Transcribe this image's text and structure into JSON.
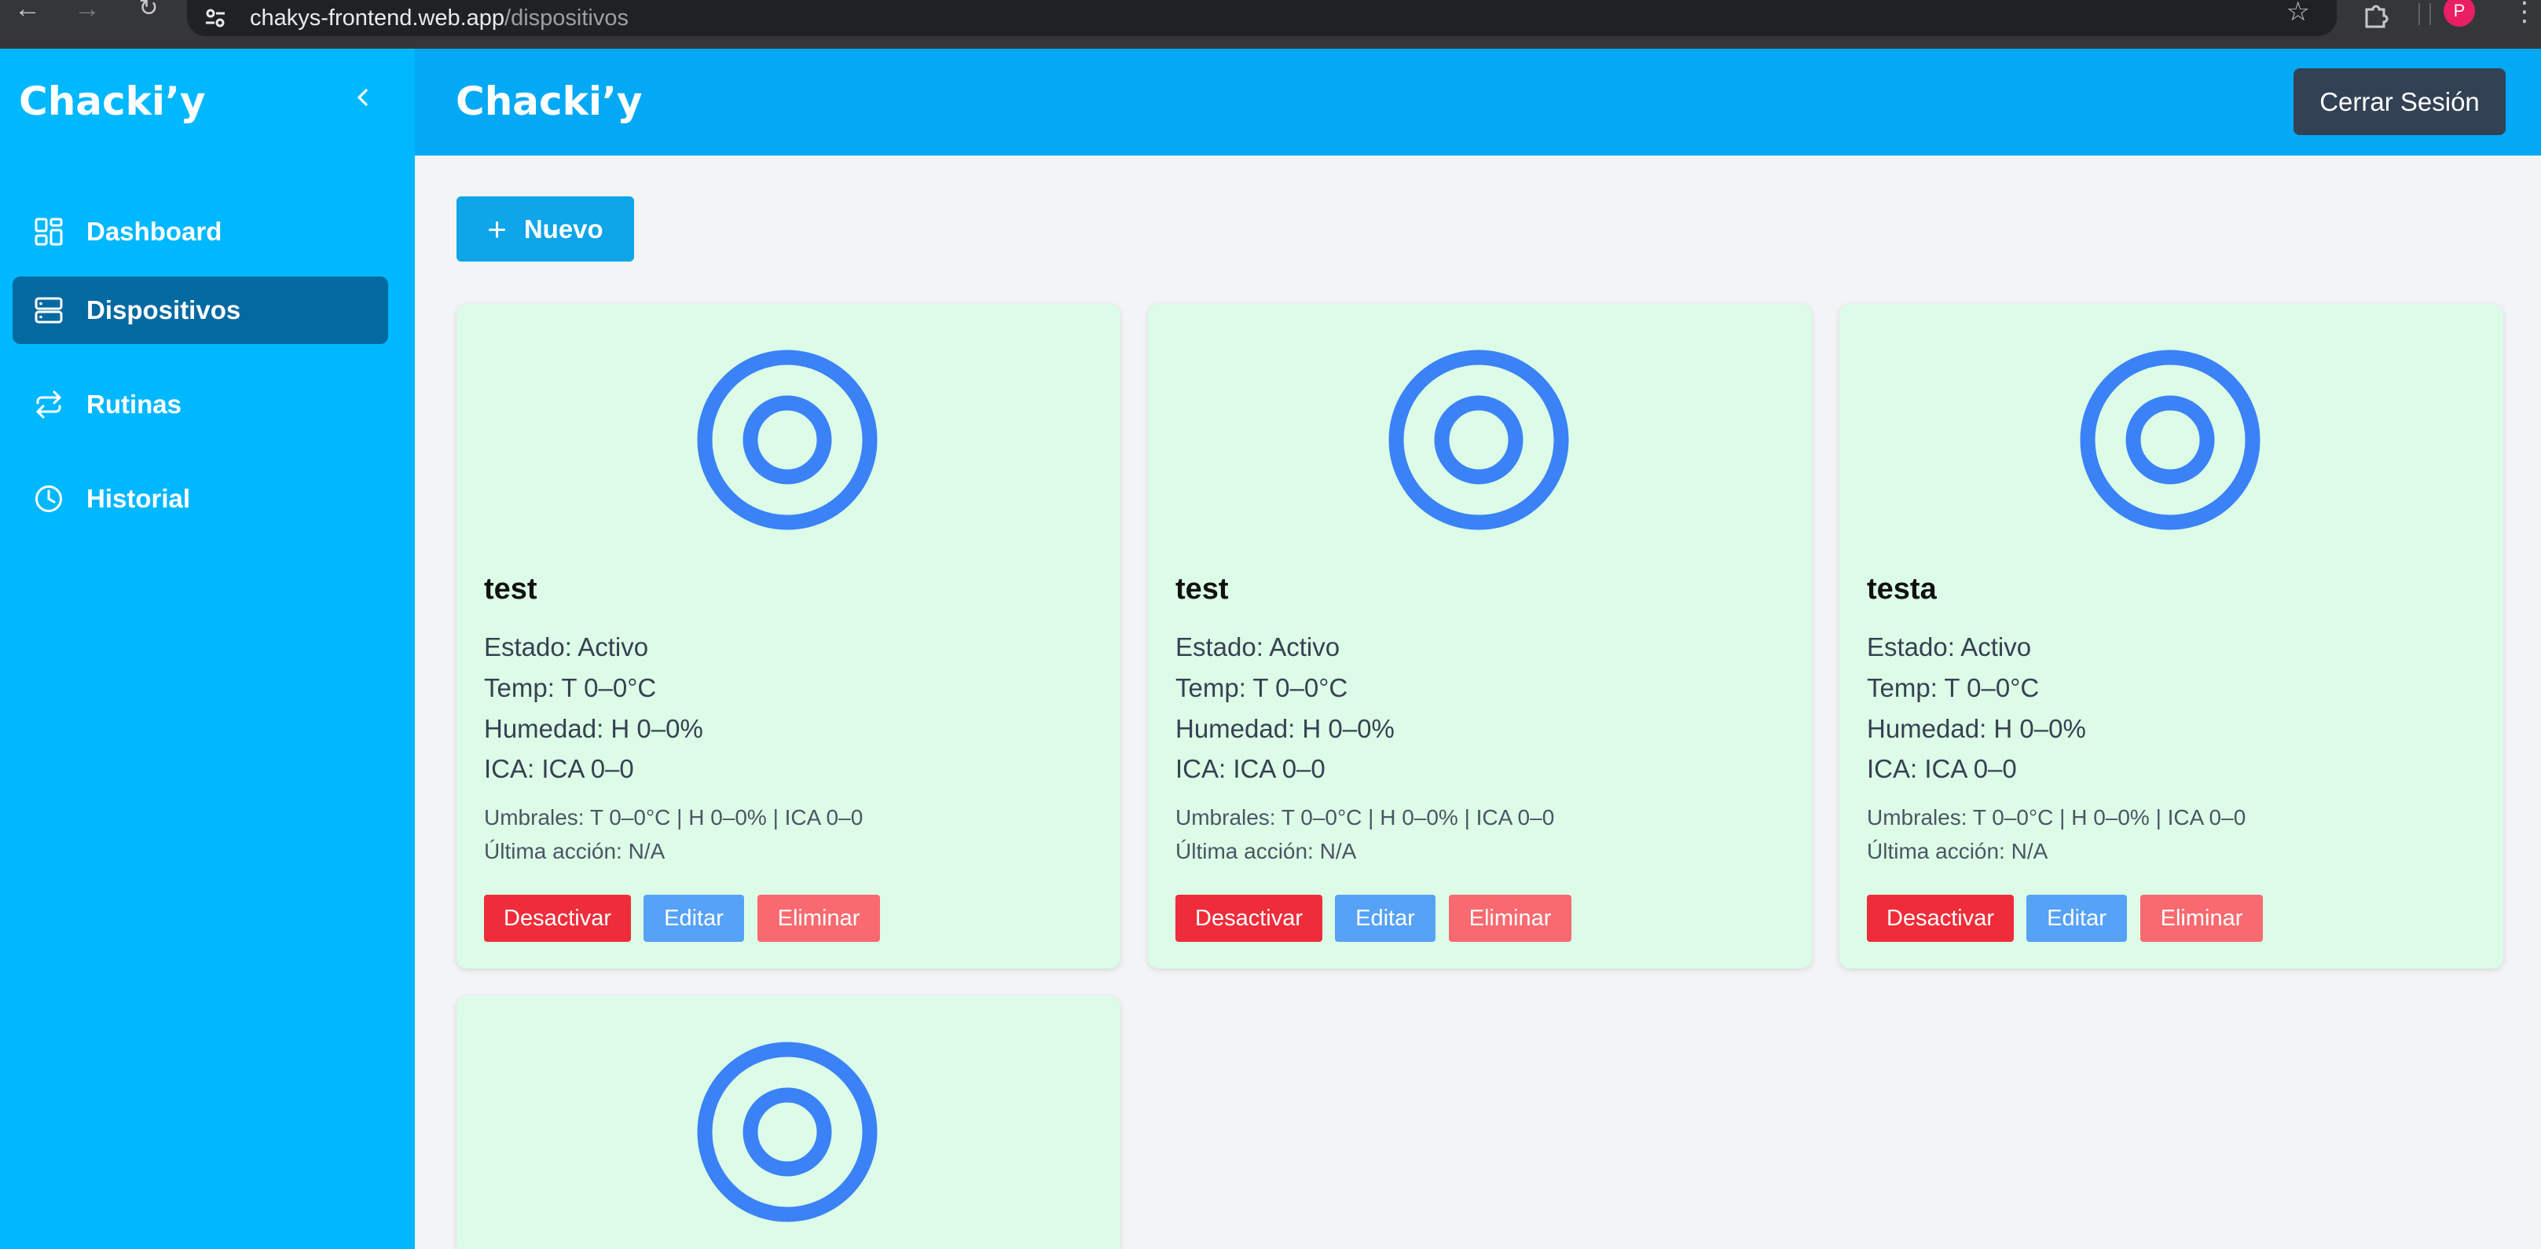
{
  "browser": {
    "url_host": "chakys-frontend.web.app",
    "url_path": "/dispositivos",
    "profile_initial": "P"
  },
  "sidebar": {
    "brand": "Chacki’y",
    "items": [
      {
        "label": "Dashboard",
        "icon": "dashboard-icon"
      },
      {
        "label": "Dispositivos",
        "icon": "server-icon",
        "active": true
      },
      {
        "label": "Rutinas",
        "icon": "repeat-icon"
      },
      {
        "label": "Historial",
        "icon": "clock-icon"
      }
    ]
  },
  "header": {
    "title": "Chacki’y",
    "logout_label": "Cerrar Sesión"
  },
  "main": {
    "new_label": "Nuevo",
    "cards": [
      {
        "name": "test",
        "estado": "Estado: Activo",
        "temp": "Temp: T 0–0°C",
        "humedad": "Humedad: H 0–0%",
        "ica": "ICA: ICA 0–0",
        "umbrales": "Umbrales: T 0–0°C | H 0–0% | ICA 0–0",
        "ultima_accion": "Última acción: N/A",
        "btn_deactivate": "Desactivar",
        "btn_edit": "Editar",
        "btn_delete": "Eliminar"
      },
      {
        "name": "test",
        "estado": "Estado: Activo",
        "temp": "Temp: T 0–0°C",
        "humedad": "Humedad: H 0–0%",
        "ica": "ICA: ICA 0–0",
        "umbrales": "Umbrales: T 0–0°C | H 0–0% | ICA 0–0",
        "ultima_accion": "Última acción: N/A",
        "btn_deactivate": "Desactivar",
        "btn_edit": "Editar",
        "btn_delete": "Eliminar"
      },
      {
        "name": "testa",
        "estado": "Estado: Activo",
        "temp": "Temp: T 0–0°C",
        "humedad": "Humedad: H 0–0%",
        "ica": "ICA: ICA 0–0",
        "umbrales": "Umbrales: T 0–0°C | H 0–0% | ICA 0–0",
        "ultima_accion": "Última acción: N/A",
        "btn_deactivate": "Desactivar",
        "btn_edit": "Editar",
        "btn_delete": "Eliminar"
      }
    ]
  },
  "colors": {
    "sidebar_bg": "#00b8ff",
    "header_bg": "#03a9f4",
    "active_item": "#0369a1",
    "card_bg": "#dcfce7",
    "icon_blue": "#3b82f6",
    "deactivate": "#ef2d3a",
    "edit": "#56a2f7",
    "delete": "#f86a70"
  }
}
